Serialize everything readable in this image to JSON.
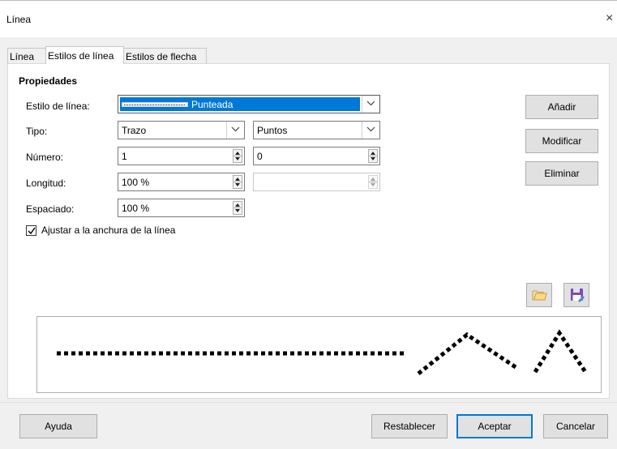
{
  "window": {
    "title": "Línea",
    "close_glyph": "×"
  },
  "tabs": [
    {
      "label": "Línea",
      "active": false
    },
    {
      "label": "Estilos de línea",
      "active": true
    },
    {
      "label": "Estilos de flecha",
      "active": false
    }
  ],
  "properties": {
    "heading": "Propiedades",
    "line_style": {
      "label": "Estilo de línea:",
      "value": "Punteada"
    },
    "type": {
      "label": "Tipo:",
      "value1": "Trazo",
      "value2": "Puntos"
    },
    "number": {
      "label": "Número:",
      "value1": "1",
      "value2": "0"
    },
    "length": {
      "label": "Longitud:",
      "value1": "100 %",
      "value2": ""
    },
    "spacing": {
      "label": "Espaciado:",
      "value": "100 %"
    },
    "fit_to_width": {
      "label": "Ajustar a la anchura de la línea",
      "checked": true
    }
  },
  "side_buttons": {
    "add": "Añadir",
    "modify": "Modificar",
    "delete": "Eliminar"
  },
  "icons": {
    "open": "folder-open-icon",
    "save": "save-icon"
  },
  "footer": {
    "help": "Ayuda",
    "reset": "Restablecer",
    "ok": "Aceptar",
    "cancel": "Cancelar"
  },
  "colors": {
    "accent": "#0078d7",
    "folder": "#e8b24a",
    "save": "#7a4bb5"
  }
}
